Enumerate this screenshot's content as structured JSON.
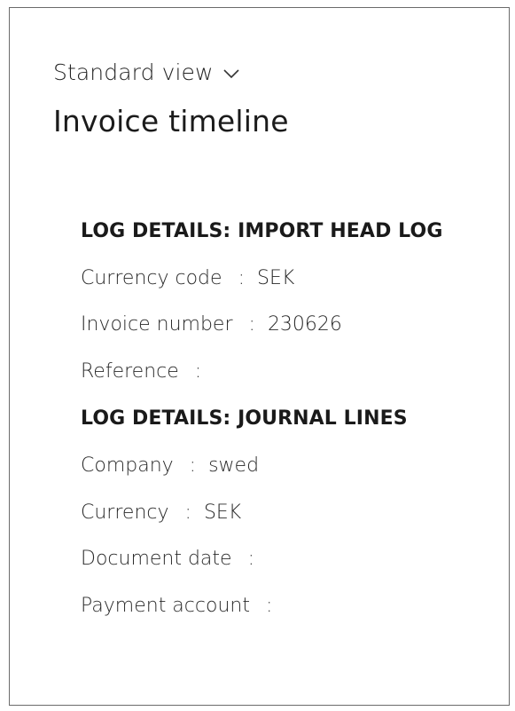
{
  "view": {
    "label": "Standard view",
    "icon": "chevron-down-icon"
  },
  "title": "Invoice timeline",
  "sections": {
    "head": {
      "heading": "LOG DETAILS: IMPORT HEAD LOG",
      "fields": [
        {
          "label": "Currency code",
          "value": "SEK"
        },
        {
          "label": "Invoice number",
          "value": "230626"
        },
        {
          "label": "Reference",
          "value": ""
        }
      ]
    },
    "lines": {
      "heading": "LOG DETAILS: JOURNAL LINES",
      "fields": [
        {
          "label": "Company",
          "value": "swed"
        },
        {
          "label": "Currency",
          "value": "SEK"
        },
        {
          "label": "Document date",
          "value": ""
        },
        {
          "label": "Payment account",
          "value": ""
        }
      ]
    }
  },
  "separator": ":"
}
